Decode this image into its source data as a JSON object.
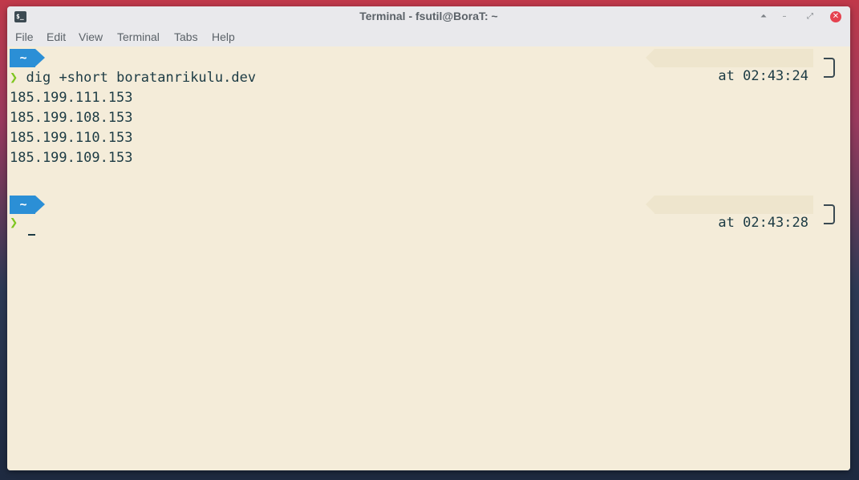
{
  "window": {
    "title": "Terminal - fsutil@BoraT: ~",
    "icon": "terminal-icon",
    "app_icon_glyph": "$_",
    "controls": {
      "up": "⏶",
      "minimize": "–",
      "maximize": "⤢",
      "close": "✕"
    }
  },
  "menu": [
    "File",
    "Edit",
    "View",
    "Terminal",
    "Tabs",
    "Help"
  ],
  "terminal": {
    "colors": {
      "background": "#f4ecd9",
      "text": "#1c3b44",
      "prompt_badge": "#2b8fd6",
      "prompt_arrow": "#7ec61f"
    },
    "blocks": [
      {
        "dir": "~",
        "time": "at 02:43:24",
        "prompt_char": "❯",
        "command": "dig +short boratanrikulu.dev",
        "output": [
          "185.199.111.153",
          "185.199.108.153",
          "185.199.110.153",
          "185.199.109.153"
        ]
      },
      {
        "dir": "~",
        "time": "at 02:43:28",
        "prompt_char": "❯",
        "command": "",
        "output": []
      }
    ]
  }
}
